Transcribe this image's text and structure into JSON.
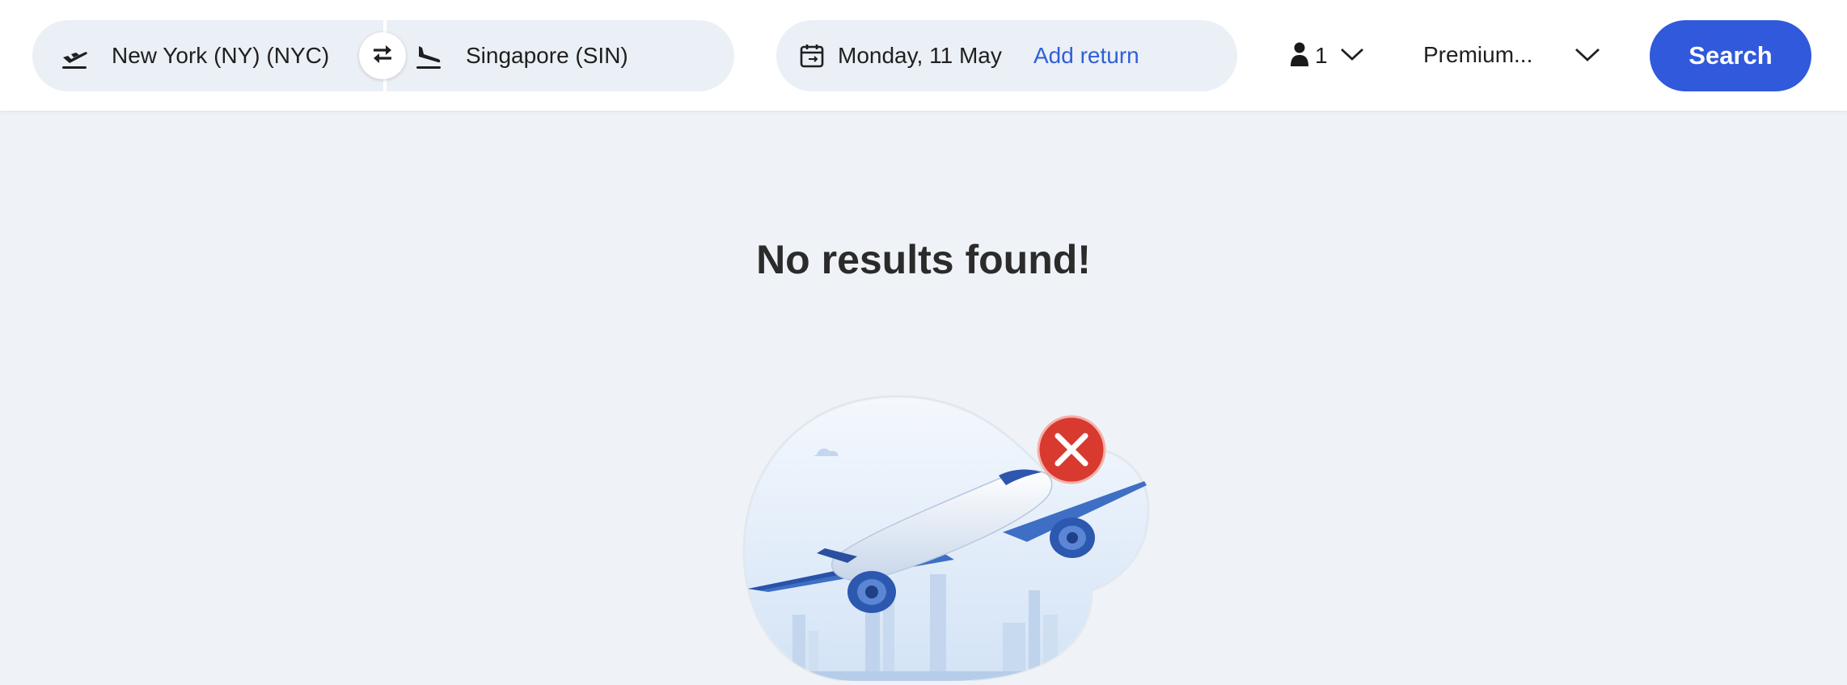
{
  "search": {
    "origin": "New York (NY) (NYC)",
    "destination": "Singapore (SIN)",
    "departure_date": "Monday, 11 May",
    "add_return_label": "Add return",
    "passengers": "1",
    "cabin_class": "Premium...",
    "search_label": "Search"
  },
  "icons": {
    "origin": "plane-takeoff-icon",
    "destination": "plane-landing-icon",
    "swap": "swap-arrows-icon",
    "calendar": "calendar-icon",
    "passenger": "person-icon",
    "dropdown": "chevron-down-icon",
    "error": "close-circle-icon"
  },
  "results": {
    "message": "No results found!"
  },
  "colors": {
    "accent": "#3059db",
    "link": "#2f5fd8",
    "page_bg": "#eff3f7",
    "pill_bg": "#ebeff6",
    "error": "#d93a2f"
  }
}
